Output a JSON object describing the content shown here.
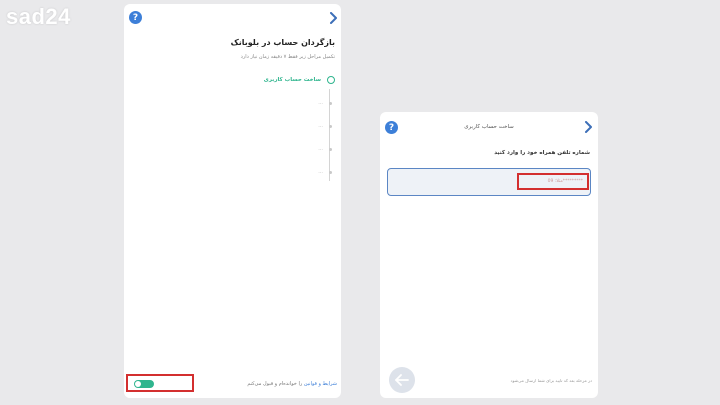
{
  "watermark": "sad24",
  "left_screen": {
    "title": "بازگردان حساب در بلوبانک",
    "subtitle": "تکمیل مراحل زیر فقط ۷ دقیقه زمان نیاز دارد",
    "steps": [
      {
        "label": "ساخت حساب کاربری",
        "active": true
      },
      {
        "label": "...",
        "active": false
      },
      {
        "label": "...",
        "active": false
      },
      {
        "label": "...",
        "active": false
      },
      {
        "label": "...",
        "active": false
      }
    ],
    "terms_link": "شرایط و قوانین",
    "terms_rest": "را خوانده‌ام و قبول می‌کنم",
    "toggle_on": true
  },
  "right_screen": {
    "header_title": "ساخت حساب کاربری",
    "phone_prompt": "شماره تلفن همراه خود را وارد کنید",
    "phone_placeholder": "مثلا: 09*********",
    "footnote": "در مرحله بعد کد تایید برای شما ارسال می‌شود"
  },
  "icons": {
    "help": "question-mark",
    "back": "chevron-right",
    "next": "arrow-left"
  },
  "colors": {
    "accent_blue": "#3d7fd8",
    "active_green": "#2fb58e",
    "highlight_red": "#d32f2f"
  }
}
